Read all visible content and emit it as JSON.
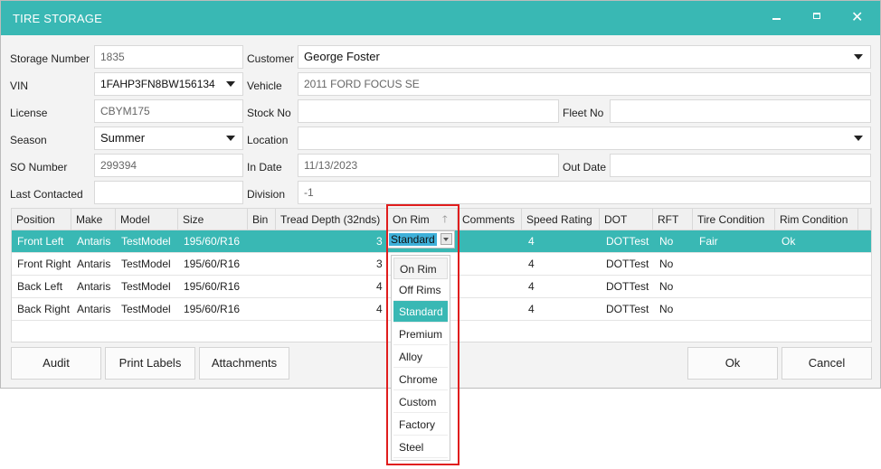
{
  "window": {
    "title": "TIRE STORAGE"
  },
  "form": {
    "storage_number": {
      "label": "Storage Number",
      "value": "1835"
    },
    "customer": {
      "label": "Customer",
      "value": "George Foster"
    },
    "vin": {
      "label": "VIN",
      "value": "1FAHP3FN8BW156134"
    },
    "vehicle": {
      "label": "Vehicle",
      "value": "2011 FORD FOCUS SE"
    },
    "license": {
      "label": "License",
      "value": "CBYM175"
    },
    "stock_no": {
      "label": "Stock No",
      "value": ""
    },
    "fleet_no": {
      "label": "Fleet No",
      "value": ""
    },
    "season": {
      "label": "Season",
      "value": "Summer"
    },
    "location": {
      "label": "Location",
      "value": ""
    },
    "so_number": {
      "label": "SO Number",
      "value": "299394"
    },
    "in_date": {
      "label": "In Date",
      "value": "11/13/2023"
    },
    "out_date": {
      "label": "Out Date",
      "value": ""
    },
    "last_contacted": {
      "label": "Last Contacted",
      "value": ""
    },
    "division": {
      "label": "Division",
      "value": "-1"
    }
  },
  "grid": {
    "columns": [
      "Position",
      "Make",
      "Model",
      "Size",
      "Bin",
      "Tread Depth (32nds)",
      "On Rim",
      "Comments",
      "Speed Rating",
      "DOT",
      "RFT",
      "Tire Condition",
      "Rim Condition"
    ],
    "rows": [
      {
        "position": "Front Left",
        "make": "Antaris",
        "model": "TestModel",
        "size": "195/60/R16",
        "bin": "",
        "tread": "3",
        "on_rim": "Standard",
        "comments": "",
        "speed": "4",
        "dot": "DOTTest",
        "rft": "No",
        "tire_condition": "Fair",
        "rim_condition": "Ok"
      },
      {
        "position": "Front Right",
        "make": "Antaris",
        "model": "TestModel",
        "size": "195/60/R16",
        "bin": "",
        "tread": "3",
        "on_rim": "",
        "comments": "",
        "speed": "4",
        "dot": "DOTTest",
        "rft": "No",
        "tire_condition": "",
        "rim_condition": ""
      },
      {
        "position": "Back Left",
        "make": "Antaris",
        "model": "TestModel",
        "size": "195/60/R16",
        "bin": "",
        "tread": "4",
        "on_rim": "",
        "comments": "",
        "speed": "4",
        "dot": "DOTTest",
        "rft": "No",
        "tire_condition": "",
        "rim_condition": ""
      },
      {
        "position": "Back Right",
        "make": "Antaris",
        "model": "TestModel",
        "size": "195/60/R16",
        "bin": "",
        "tread": "4",
        "on_rim": "",
        "comments": "",
        "speed": "4",
        "dot": "DOTTest",
        "rft": "No",
        "tire_condition": "",
        "rim_condition": ""
      }
    ]
  },
  "on_rim_editor": {
    "value": "Standard"
  },
  "on_rim_options": [
    "On Rim",
    "Off Rims",
    "Standard",
    "Premium",
    "Alloy",
    "Chrome",
    "Custom",
    "Factory",
    "Steel"
  ],
  "buttons": {
    "audit": "Audit",
    "print_labels": "Print Labels",
    "attachments": "Attachments",
    "ok": "Ok",
    "cancel": "Cancel"
  },
  "colors": {
    "accent": "#39b8b4",
    "highlight": "#e01d1d"
  }
}
